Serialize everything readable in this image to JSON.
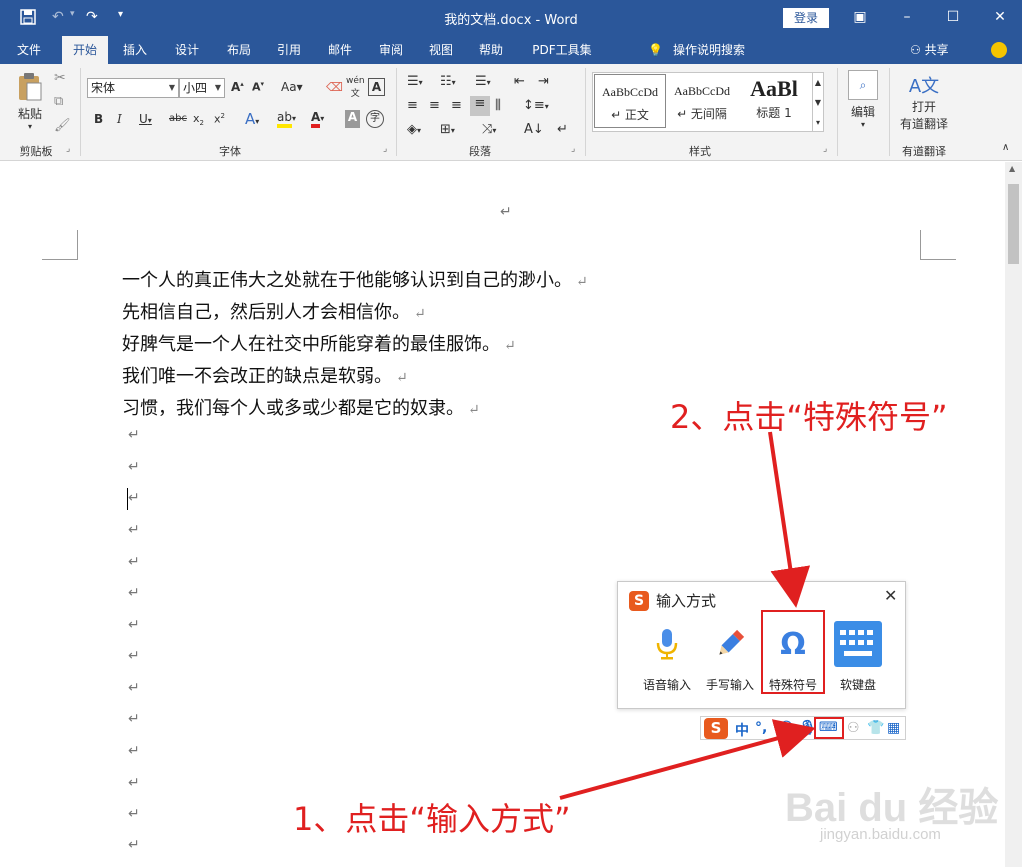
{
  "window": {
    "title": "我的文档.docx - Word",
    "login_label": "登录"
  },
  "tabs": [
    "文件",
    "开始",
    "插入",
    "设计",
    "布局",
    "引用",
    "邮件",
    "审阅",
    "视图",
    "帮助",
    "PDF工具集"
  ],
  "active_tab": "开始",
  "tell_me": "操作说明搜索",
  "share_label": "共享",
  "ribbon": {
    "clipboard": {
      "paste_label": "粘贴",
      "group_label": "剪贴板"
    },
    "font": {
      "font_name": "宋体",
      "font_size": "小四",
      "group_label": "字体"
    },
    "paragraph": {
      "group_label": "段落"
    },
    "styles": {
      "group_label": "样式",
      "items": [
        {
          "sample": "AaBbCcDd",
          "name": "↵ 正文"
        },
        {
          "sample": "AaBbCcDd",
          "name": "↵ 无间隔"
        },
        {
          "sample": "AaBl",
          "name": "标题 1"
        }
      ]
    },
    "editing": {
      "label": "编辑"
    },
    "translate": {
      "open_label": "打开",
      "sub_label": "有道翻译",
      "group_label": "有道翻译"
    }
  },
  "document": {
    "lines": [
      "一个人的真正伟大之处就在于他能够认识到自己的渺小。",
      "先相信自己，然后别人才会相信你。",
      "好脾气是一个人在社交中所能穿着的最佳服饰。",
      "我们唯一不会改正的缺点是软弱。",
      "习惯，我们每个人或多或少都是它的奴隶。"
    ],
    "para_mark": "↵"
  },
  "ime_panel": {
    "title": "输入方式",
    "items": [
      {
        "label": "语音输入",
        "icon": "microphone-icon"
      },
      {
        "label": "手写输入",
        "icon": "pencil-icon"
      },
      {
        "label": "特殊符号",
        "icon": "omega-icon"
      },
      {
        "label": "软键盘",
        "icon": "keyboard-icon"
      }
    ],
    "toolbar": {
      "mode": "中"
    }
  },
  "annotations": {
    "step1": "1、点击“输入方式”",
    "step2": "2、点击“特殊符号”"
  },
  "watermark": {
    "main": "Bai du 经验",
    "sub": "jingyan.baidu.com"
  },
  "colors": {
    "brand": "#2b579a",
    "annotation": "#e02020",
    "sogou": "#e85a1e"
  }
}
